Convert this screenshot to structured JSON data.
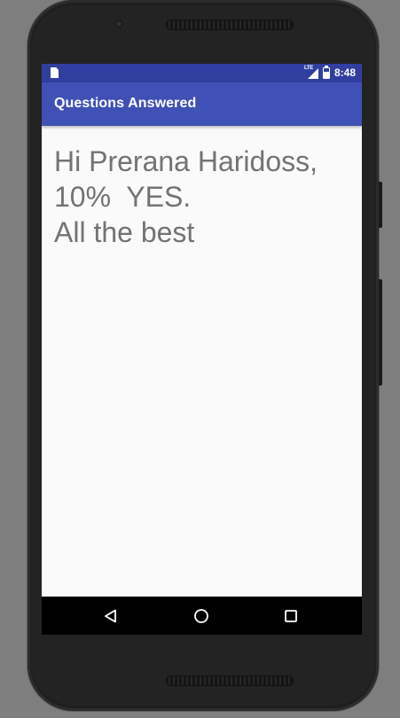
{
  "status_bar": {
    "time": "8:48",
    "network_label": "LTE",
    "icons": [
      "sd-card-icon",
      "lte-signal-icon",
      "battery-icon"
    ],
    "battery_level": 0.6,
    "background_color": "#303f9f"
  },
  "app_bar": {
    "title": "Questions Answered",
    "background_color": "#3f51b5"
  },
  "content": {
    "lines": [
      "Hi Prerana Haridoss,",
      "10%  YES.",
      "All the best"
    ],
    "text_color": "#737373"
  },
  "nav_bar": {
    "buttons": [
      "back-icon",
      "home-icon",
      "recents-icon"
    ]
  }
}
